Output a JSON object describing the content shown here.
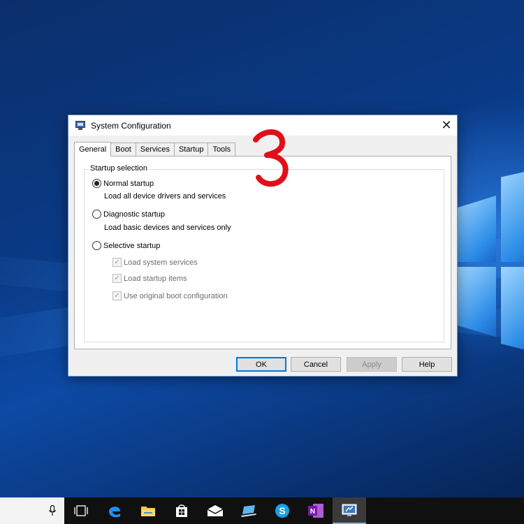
{
  "window": {
    "title": "System Configuration",
    "close_glyph": "✕"
  },
  "tabs": [
    {
      "label": "General",
      "active": true
    },
    {
      "label": "Boot",
      "active": false
    },
    {
      "label": "Services",
      "active": false
    },
    {
      "label": "Startup",
      "active": false
    },
    {
      "label": "Tools",
      "active": false
    }
  ],
  "startup_selection": {
    "legend": "Startup selection",
    "normal": {
      "label": "Normal startup",
      "description": "Load all device drivers and services",
      "selected": true
    },
    "diagnostic": {
      "label": "Diagnostic startup",
      "description": "Load basic devices and services only",
      "selected": false
    },
    "selective": {
      "label": "Selective startup",
      "selected": false
    },
    "options": [
      {
        "label": "Load system services",
        "checked": true,
        "enabled": false
      },
      {
        "label": "Load startup items",
        "checked": true,
        "enabled": false
      },
      {
        "label": "Use original boot configuration",
        "checked": true,
        "enabled": false
      }
    ]
  },
  "buttons": {
    "ok": "OK",
    "cancel": "Cancel",
    "apply": "Apply",
    "help": "Help"
  },
  "annotation": {
    "step_number": "3",
    "color": "#e0101a"
  },
  "taskbar": {
    "items": [
      "microphone-icon",
      "task-view-icon",
      "edge-icon",
      "file-explorer-icon",
      "store-icon",
      "mail-icon",
      "connect-icon",
      "skype-icon",
      "onenote-icon",
      "system-configuration-icon"
    ],
    "active_item": "system-configuration-icon"
  },
  "colors": {
    "accent": "#0078d7",
    "dialog_bg": "#f0f0f0",
    "taskbar_bg": "#101010"
  }
}
